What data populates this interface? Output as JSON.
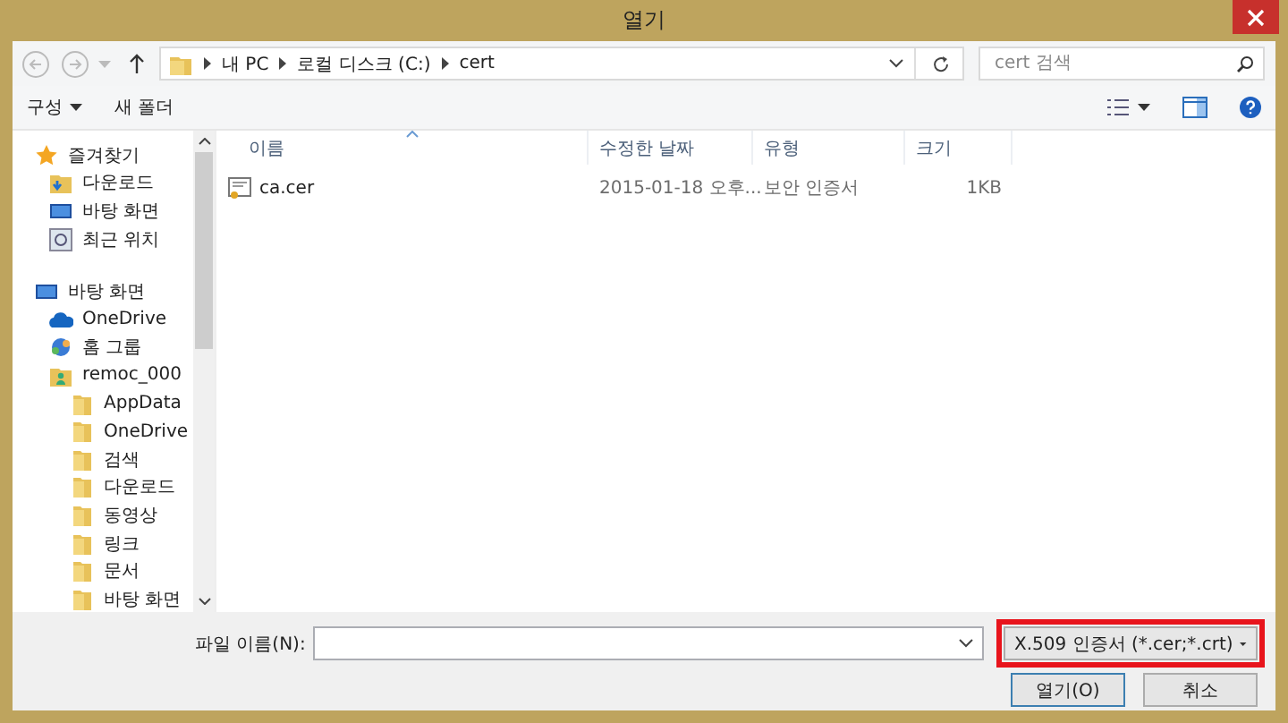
{
  "window": {
    "title": "열기"
  },
  "address": {
    "path": [
      {
        "label": "내 PC"
      },
      {
        "label": "로컬 디스크 (C:)"
      },
      {
        "label": "cert"
      }
    ],
    "search_placeholder": "cert 검색"
  },
  "toolbar": {
    "organize": "구성",
    "new_folder": "새 폴더"
  },
  "sidebar": {
    "groups": [
      {
        "label": "즐겨찾기",
        "kind": "star",
        "children": [
          {
            "label": "다운로드",
            "kind": "download"
          },
          {
            "label": "바탕 화면",
            "kind": "monitor"
          },
          {
            "label": "최근 위치",
            "kind": "recent"
          }
        ]
      },
      {
        "label": "바탕 화면",
        "kind": "monitor",
        "children": [
          {
            "label": "OneDrive",
            "kind": "cloud"
          },
          {
            "label": "홈 그룹",
            "kind": "network"
          },
          {
            "label": "remoc_000",
            "kind": "user",
            "children": [
              {
                "label": "AppData",
                "kind": "folder"
              },
              {
                "label": "OneDrive",
                "kind": "folder"
              },
              {
                "label": "검색",
                "kind": "folder"
              },
              {
                "label": "다운로드",
                "kind": "folder"
              },
              {
                "label": "동영상",
                "kind": "folder"
              },
              {
                "label": "링크",
                "kind": "folder"
              },
              {
                "label": "문서",
                "kind": "folder"
              },
              {
                "label": "바탕 화면",
                "kind": "folder"
              }
            ]
          }
        ]
      }
    ]
  },
  "table": {
    "columns": [
      "이름",
      "수정한 날짜",
      "유형",
      "크기"
    ],
    "rows": [
      {
        "name": "ca.cer",
        "modified": "2015-01-18 오후...",
        "type": "보안 인증서",
        "size": "1KB"
      }
    ]
  },
  "footer": {
    "filename_label": "파일 이름(N):",
    "filter": "X.509 인증서 (*.cer;*.crt)",
    "buttons": [
      "열기(O)",
      "취소"
    ]
  }
}
